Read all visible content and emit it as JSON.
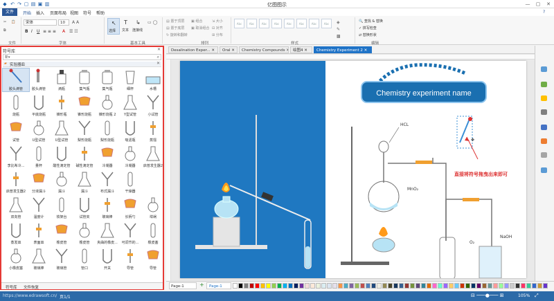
{
  "app": {
    "title": "亿图图示"
  },
  "menu": {
    "file": "文件",
    "items": [
      "开始",
      "插入",
      "页面布局",
      "视图",
      "符号",
      "帮助"
    ]
  },
  "ribbon": {
    "groups": [
      "文件",
      "字体",
      "基本工具",
      "排列",
      "样式",
      "编辑"
    ],
    "font_name": "宋体",
    "font_size": "10",
    "tools": [
      "选择",
      "文本",
      "连接线"
    ],
    "arrange_items": [
      "置于顶层",
      "置于底层",
      "组合",
      "取消组合",
      "旋转和翻转",
      "大小",
      "对齐",
      "分布"
    ],
    "edit_items": [
      "查找 & 替换",
      "拼写检查",
      "替换形状"
    ]
  },
  "library": {
    "title": "符号库",
    "section": "实验器皿",
    "search_placeholder": "",
    "rows": [
      [
        "胶头滴管",
        "胶头滴管",
        "滴瓶",
        "集气瓶",
        "集气瓶",
        "细杯",
        "水槽"
      ],
      [
        "烧瓶",
        "平底烧瓶",
        "锥形瓶",
        "锥形烧瓶",
        "锥形烧瓶 2",
        "Y型试管",
        "小试管"
      ],
      [
        "试管",
        "U型试管",
        "U型试管",
        "梨形烧瓶",
        "梨形烧瓶",
        "吸滤瓶",
        "蒸馏"
      ],
      [
        "李比希冷...",
        "量杯",
        "酸性滴定管",
        "碱性滴定管",
        "冷凝器",
        "冷凝器",
        "启普发生器2"
      ],
      [
        "启普发生器2",
        "分液漏斗",
        "漏斗",
        "漏斗",
        "布式漏斗",
        "干燥器"
      ],
      [
        "双向管",
        "温度计",
        "铁架台",
        "试管夹",
        "玻璃棒",
        "长柄勺",
        "坩埚"
      ],
      [
        "蒸发皿",
        "表面皿",
        "橡皮管",
        "橡皮管",
        "夹曲的橡皮...",
        "可调节的...",
        "橡皮塞"
      ],
      [
        "小橡皮塞",
        "玻璃棒",
        "玻璃管",
        "管口",
        "开关",
        "导管",
        "导管"
      ]
    ],
    "bottom_tabs": [
      "符号库",
      "文件恢复"
    ]
  },
  "tabs": [
    "Desalination Exper...",
    "Oral",
    "Chemistry Compounds",
    "绘图4",
    "Chemistry Experiment 2"
  ],
  "diagram": {
    "title_box": "Chemistry experiment name",
    "labels": {
      "hcl": "HCL",
      "mno2": "MnO₂",
      "o2": "O₂",
      "naoh": "NaOH"
    },
    "annotation": "直接将符号拖曳出来即可"
  },
  "pages": {
    "tab": "Page-1",
    "active": "Page-1"
  },
  "status": {
    "url": "https://www.edrawsoft.cn/",
    "page": "页1/1",
    "zoom": "105%"
  },
  "colors": {
    "accent": "#2b5797",
    "highlight": "#e53935",
    "title_box": "#1a6fb0"
  }
}
